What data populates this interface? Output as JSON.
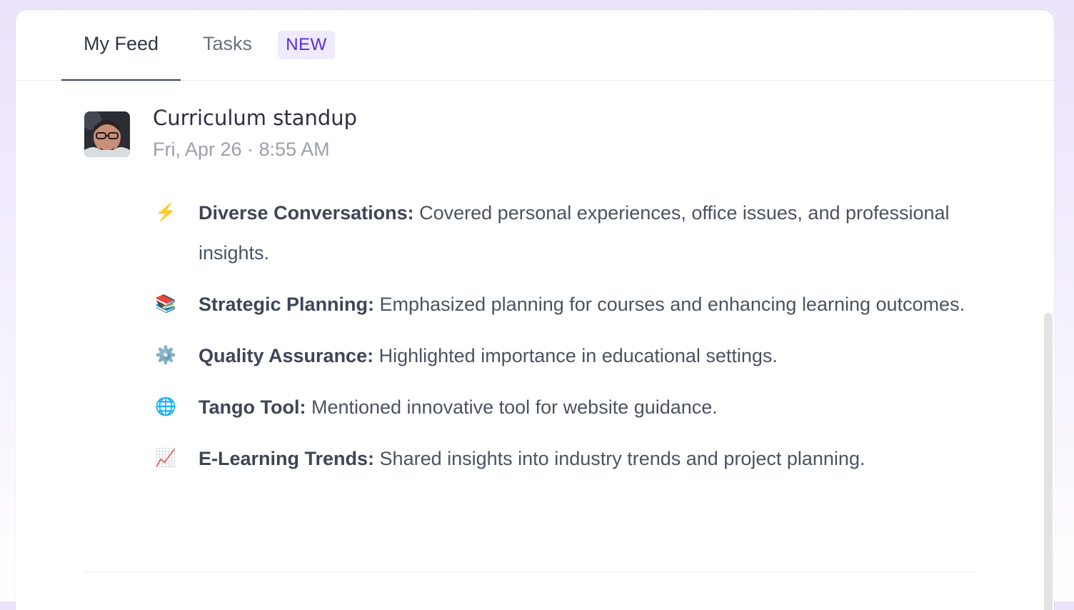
{
  "tabs": {
    "my_feed": "My Feed",
    "tasks": "Tasks",
    "new_badge": "NEW"
  },
  "post": {
    "title": "Curriculum standup",
    "meta": "Fri, Apr 26 · 8:55 AM",
    "items": [
      {
        "emoji": "⚡",
        "icon": "lightning-icon",
        "heading": "Diverse Conversations:",
        "text": " Covered personal experiences, office issues, and professional insights."
      },
      {
        "emoji": "📚",
        "icon": "books-icon",
        "heading": "Strategic Planning:",
        "text": " Emphasized planning for courses and enhancing learning outcomes."
      },
      {
        "emoji": "⚙️",
        "icon": "gear-icon",
        "heading": "Quality Assurance:",
        "text": " Highlighted importance in educational settings."
      },
      {
        "emoji": "🌐",
        "icon": "globe-icon",
        "heading": "Tango Tool:",
        "text": " Mentioned innovative tool for website guidance."
      },
      {
        "emoji": "📈",
        "icon": "chart-increasing-icon",
        "heading": "E-Learning Trends:",
        "text": " Shared insights into industry trends and project planning."
      }
    ]
  },
  "colors": {
    "accent": "#5b2bd8",
    "badge_bg": "#efeafd",
    "text": "#424a59",
    "muted": "#9aa0ab"
  }
}
